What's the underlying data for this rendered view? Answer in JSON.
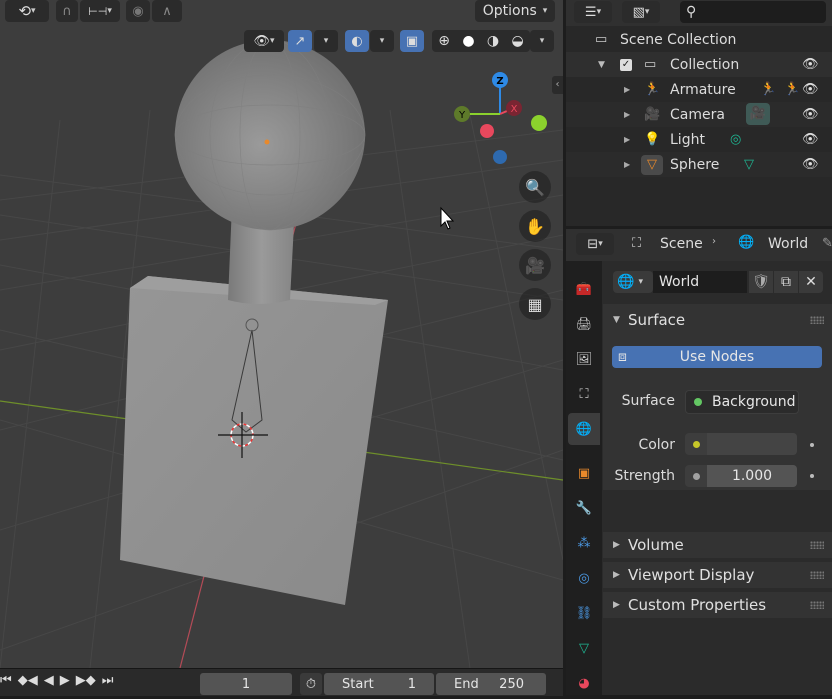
{
  "viewport": {
    "options_label": "Options"
  },
  "timeline": {
    "current_frame": "1",
    "start_label": "Start",
    "start_value": "1",
    "end_label": "End",
    "end_value": "250"
  },
  "outliner": {
    "scene_collection": "Scene Collection",
    "collection": "Collection",
    "items": [
      {
        "label": "Armature"
      },
      {
        "label": "Camera"
      },
      {
        "label": "Light"
      },
      {
        "label": "Sphere"
      }
    ]
  },
  "properties": {
    "scene_label": "Scene",
    "world_label": "World",
    "world_name": "World",
    "surface_panel": "Surface",
    "use_nodes": "Use Nodes",
    "surface_label": "Surface",
    "surface_value": "Background",
    "color_label": "Color",
    "strength_label": "Strength",
    "strength_value": "1.000",
    "volume_panel": "Volume",
    "viewport_display_panel": "Viewport Display",
    "custom_properties_panel": "Custom Properties"
  },
  "colors": {
    "accent": "#4772b3",
    "axis_x": "#e8485d",
    "axis_y": "#8bd12d",
    "axis_z": "#2e8ae6",
    "object_orange": "#e8892b",
    "data_green": "#1fb894"
  }
}
